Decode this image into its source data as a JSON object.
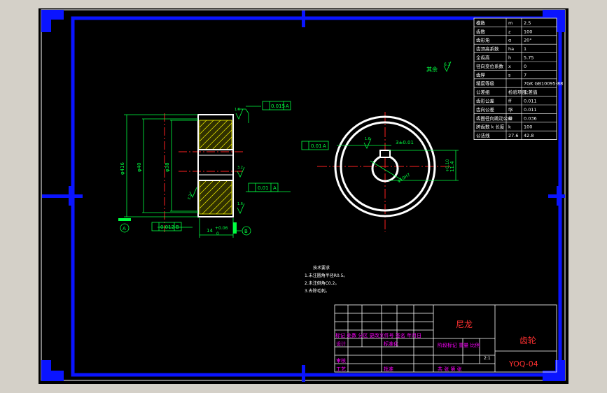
{
  "colors": {
    "background": "#000000",
    "window": "#d4d0c8",
    "frame": "#0a14ff",
    "lines": "#ffffff",
    "dimension": "#00ff40",
    "centerline": "#ff2020",
    "hatch": "#ffff00",
    "title_magenta": "#ff00ff",
    "title_red": "#ff3030"
  },
  "param_table": [
    {
      "name": "模数",
      "sym": "m",
      "val": "2.5"
    },
    {
      "name": "齿数",
      "sym": "z",
      "val": "100"
    },
    {
      "name": "齿形角",
      "sym": "α",
      "val": "20°"
    },
    {
      "name": "齿顶高系数",
      "sym": "ha",
      "val": "1"
    },
    {
      "name": "全齿高",
      "sym": "h",
      "val": "5.75"
    },
    {
      "name": "径向变位系数",
      "sym": "x",
      "val": "0"
    },
    {
      "name": "齿厚",
      "sym": "s",
      "val": "7"
    },
    {
      "name": "精度等级",
      "sym": "",
      "val": "7GK GB10095-88"
    },
    {
      "name": "公差组",
      "sym": "检验项目",
      "val": "公差值"
    },
    {
      "name": "齿形公差",
      "sym": "ff",
      "val": "0.011"
    },
    {
      "name": "齿向公差",
      "sym": "fβ",
      "val": "0.011"
    },
    {
      "name": "齿圈径向跳动公差",
      "sym": "Fr",
      "val": "0.036"
    },
    {
      "name": "跨齿数 k 长度",
      "sym": "k",
      "val": "100"
    },
    {
      "name": "公法线",
      "sym": "27.6",
      "val": "42.8"
    }
  ],
  "labels": {
    "surface_finish": "其余",
    "finish_value": "6.3",
    "tol_runout": "0.015",
    "ref_a_top": "A",
    "tol_parallel": "0.01",
    "ref_a_right": "A",
    "tol_perp": "0.01",
    "ref_a_mid": "A",
    "tol_bottom": "0.012",
    "ref_b": "B",
    "datum_a": "A",
    "datum_b": "B",
    "dim_width": "14",
    "dim_width_tol": "+0.06",
    "dim_width_tol2": "0",
    "dim_d1": "φ416",
    "dim_d2": "φ40",
    "dim_d3": "φ38",
    "dim_key": "3±0.01",
    "dim_height": "11.4",
    "dim_height_tol": "+0.10",
    "dim_hole": "φ10H7",
    "rough_1": "1.6",
    "rough_2": "3.2",
    "rough_3": "1.6",
    "rough_4": "3.2",
    "rough_5": "1.6"
  },
  "notes": {
    "title": "技术要求",
    "lines": [
      "1.未注圆角半径R0.5。",
      "2.未注倒角C0.2。",
      "3.去除毛刺。"
    ]
  },
  "title_block": {
    "material": "尼龙",
    "part_name": "齿轮",
    "drawing_no": "YOQ-04",
    "header_row": "标记 处数 分区 更改文件号 签名 年月日",
    "designer": "设计",
    "standardize": "标准化",
    "check": "审核",
    "process": "工艺",
    "approve": "批准",
    "stage_row": "阶段标记  重量  比例",
    "scale": "2:1",
    "sheets_row": "共  张  第  张"
  }
}
